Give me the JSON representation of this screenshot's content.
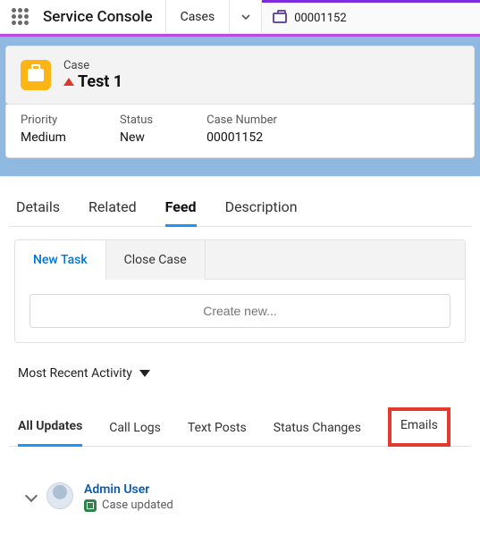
{
  "appbar": {
    "title": "Service Console",
    "nav_item": "Cases",
    "workspace_tab": "00001152"
  },
  "record": {
    "object_label": "Case",
    "title": "Test 1"
  },
  "highlights": {
    "priority_label": "Priority",
    "priority_value": "Medium",
    "status_label": "Status",
    "status_value": "New",
    "casenum_label": "Case Number",
    "casenum_value": "00001152"
  },
  "tabs": {
    "details": "Details",
    "related": "Related",
    "feed": "Feed",
    "description": "Description"
  },
  "subtabs": {
    "new_task": "New Task",
    "close_case": "Close Case"
  },
  "create_placeholder": "Create new...",
  "sort_label": "Most Recent Activity",
  "feed_filters": {
    "all": "All Updates",
    "call": "Call Logs",
    "text": "Text Posts",
    "status": "Status Changes",
    "emails": "Emails"
  },
  "feed_entry": {
    "user": "Admin User",
    "subtitle": "Case updated"
  }
}
